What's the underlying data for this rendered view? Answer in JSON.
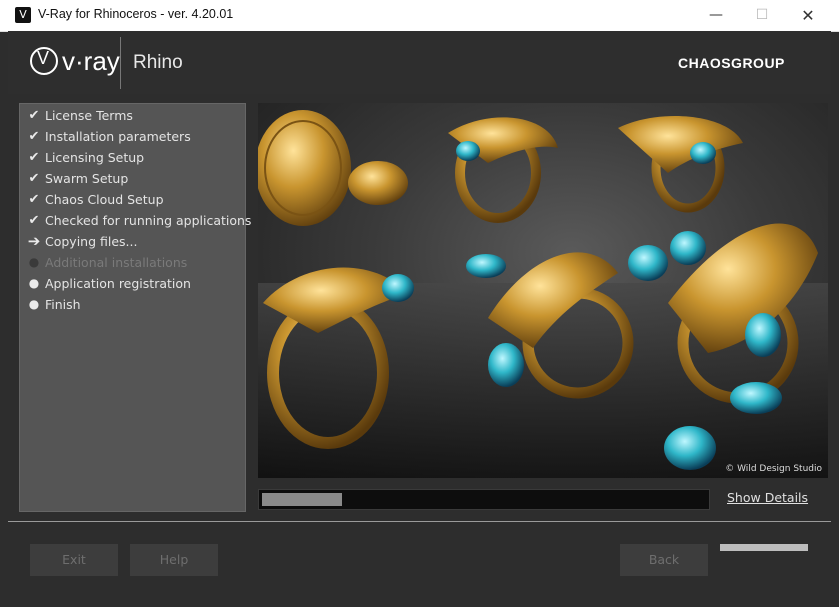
{
  "window": {
    "title": "V-Ray for Rhinoceros - ver. 4.20.01",
    "minimize_glyph": "—",
    "maximize_glyph": "☐",
    "close_glyph": "✕"
  },
  "header": {
    "vray_brand": "v·ray",
    "product": "Rhino",
    "chaos_brand": "CHAOSGROUP"
  },
  "steps": [
    {
      "label": "License Terms",
      "state": "done",
      "icon": "check-icon"
    },
    {
      "label": "Installation parameters",
      "state": "done",
      "icon": "check-icon"
    },
    {
      "label": "Licensing Setup",
      "state": "done",
      "icon": "check-icon"
    },
    {
      "label": "Swarm Setup",
      "state": "done",
      "icon": "check-icon"
    },
    {
      "label": "Chaos Cloud Setup",
      "state": "done",
      "icon": "check-icon"
    },
    {
      "label": "Checked for running applications",
      "state": "done",
      "icon": "check-icon"
    },
    {
      "label": "Copying files...",
      "state": "current",
      "icon": "arrow-right-icon"
    },
    {
      "label": "Additional installations",
      "state": "disabled",
      "icon": "dot-icon"
    },
    {
      "label": "Application registration",
      "state": "pending",
      "icon": "dot-icon"
    },
    {
      "label": "Finish",
      "state": "pending",
      "icon": "dot-icon"
    }
  ],
  "hero": {
    "caption": "© Wild Design Studio"
  },
  "progress": {
    "fraction": 0.18,
    "link_label": "Show Details"
  },
  "buttons": {
    "exit": "Exit",
    "help": "Help",
    "back": "Back"
  },
  "colors": {
    "background": "#2d2d2d",
    "steps_panel": "#555555",
    "gold": "#c9952f",
    "gem": "#2fb7c9"
  }
}
